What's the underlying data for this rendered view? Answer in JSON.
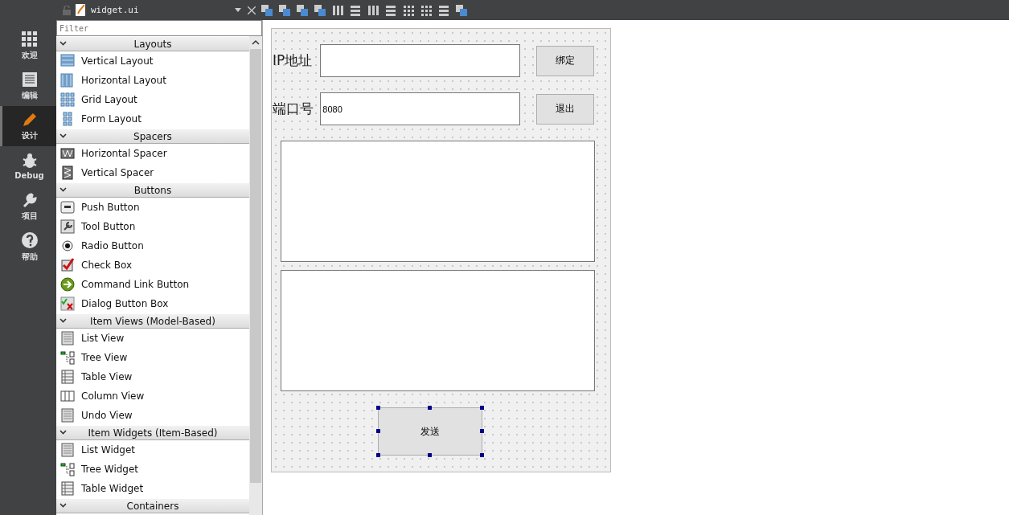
{
  "toolbar": {
    "file": "widget.ui"
  },
  "modes": [
    {
      "label": "欢迎",
      "selected": false
    },
    {
      "label": "编辑",
      "selected": false
    },
    {
      "label": "设计",
      "selected": true
    },
    {
      "label": "Debug",
      "selected": false
    },
    {
      "label": "项目",
      "selected": false
    },
    {
      "label": "帮助",
      "selected": false
    }
  ],
  "widget_box": {
    "filter_placeholder": "Filter",
    "sections": [
      {
        "title": "Layouts",
        "expanded": true,
        "items": [
          "Vertical Layout",
          "Horizontal Layout",
          "Grid Layout",
          "Form Layout"
        ]
      },
      {
        "title": "Spacers",
        "expanded": true,
        "items": [
          "Horizontal Spacer",
          "Vertical Spacer"
        ]
      },
      {
        "title": "Buttons",
        "expanded": true,
        "items": [
          "Push Button",
          "Tool Button",
          "Radio Button",
          "Check Box",
          "Command Link Button",
          "Dialog Button Box"
        ]
      },
      {
        "title": "Item Views (Model-Based)",
        "expanded": true,
        "items": [
          "List View",
          "Tree View",
          "Table View",
          "Column View",
          "Undo View"
        ]
      },
      {
        "title": "Item Widgets (Item-Based)",
        "expanded": true,
        "items": [
          "List Widget",
          "Tree Widget",
          "Table Widget"
        ]
      },
      {
        "title": "Containers",
        "expanded": true
      }
    ]
  },
  "form": {
    "ip_label": "IP地址",
    "port_label": "端口号",
    "port_value": "8080",
    "bind_button": "绑定",
    "quit_button": "退出",
    "send_button": "发送",
    "send_selected": true
  }
}
